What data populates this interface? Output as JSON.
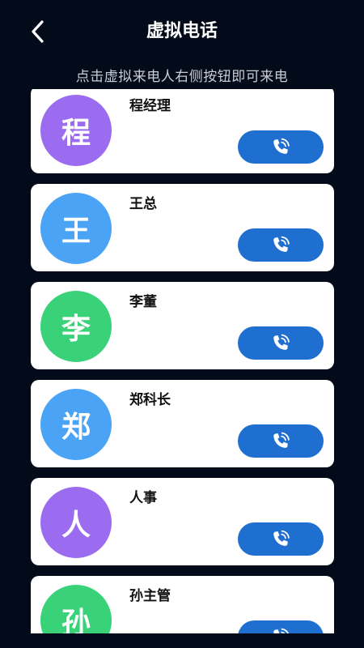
{
  "header": {
    "title": "虚拟电话",
    "back_icon": "chevron-left-icon"
  },
  "hint": "点击虚拟来电人右侧按钮即可来电",
  "colors": {
    "background": "#030b1a",
    "call_button": "#1f6fd1"
  },
  "contacts": [
    {
      "name": "程经理",
      "avatar_char": "程",
      "avatar_color": "#9b6cf0"
    },
    {
      "name": "王总",
      "avatar_char": "王",
      "avatar_color": "#4aa3f5"
    },
    {
      "name": "李董",
      "avatar_char": "李",
      "avatar_color": "#39d279"
    },
    {
      "name": "郑科长",
      "avatar_char": "郑",
      "avatar_color": "#4aa3f5"
    },
    {
      "name": "人事",
      "avatar_char": "人",
      "avatar_color": "#9b6cf0"
    },
    {
      "name": "孙主管",
      "avatar_char": "孙",
      "avatar_color": "#39d279"
    }
  ],
  "call_icon": "phone-ring-icon"
}
